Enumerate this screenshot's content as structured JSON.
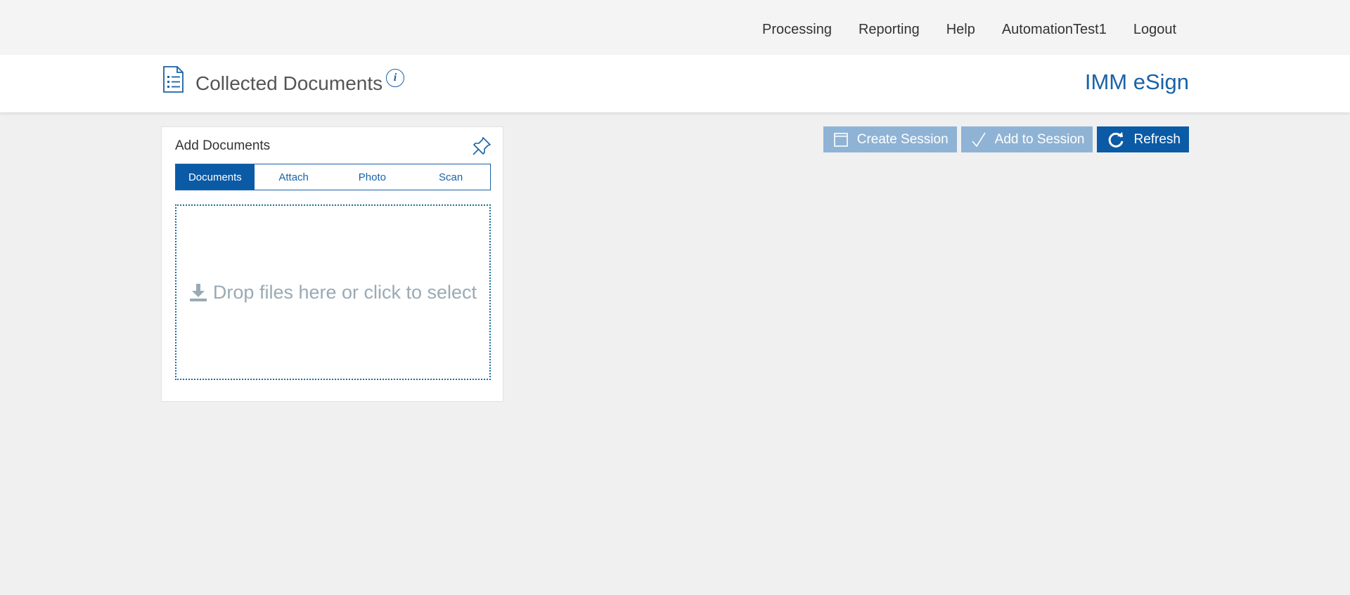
{
  "nav": {
    "links": [
      "Processing",
      "Reporting",
      "Help",
      "AutomationTest1",
      "Logout"
    ]
  },
  "header": {
    "title": "Collected Documents",
    "info_icon": "info-icon",
    "brand": "IMM eSign"
  },
  "panel": {
    "title": "Add Documents",
    "pin_icon": "pin-icon",
    "tabs": [
      {
        "label": "Documents",
        "active": true
      },
      {
        "label": "Attach",
        "active": false
      },
      {
        "label": "Photo",
        "active": false
      },
      {
        "label": "Scan",
        "active": false
      }
    ],
    "dropzone_text": "Drop files here or click to select",
    "dropzone_icon": "download-icon"
  },
  "actions": {
    "create_session": {
      "label": "Create Session",
      "icon": "window-icon",
      "enabled": false
    },
    "add_to_session": {
      "label": "Add to Session",
      "icon": "check-icon",
      "enabled": false
    },
    "refresh": {
      "label": "Refresh",
      "icon": "refresh-icon",
      "enabled": true
    }
  },
  "colors": {
    "accent": "#0b5aa6",
    "disabled_button": "#8fb3d4",
    "page_background": "#f0f0f0"
  }
}
